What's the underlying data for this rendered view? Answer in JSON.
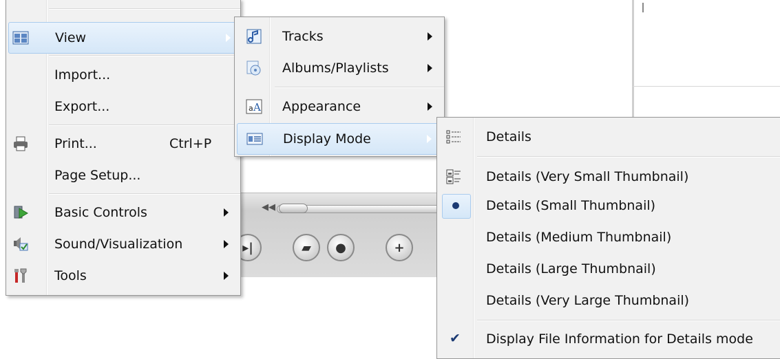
{
  "file_menu": {
    "items": [
      {
        "label": "View",
        "icon": "view-grid-icon",
        "submenu": true,
        "highlighted": true
      },
      {
        "label": "Import..."
      },
      {
        "label": "Export..."
      },
      {
        "label": "Print...",
        "icon": "printer-icon",
        "shortcut": "Ctrl+P"
      },
      {
        "label": "Page Setup..."
      },
      {
        "label": "Basic Controls",
        "icon": "basic-controls-icon",
        "submenu": true
      },
      {
        "label": "Sound/Visualization",
        "icon": "sound-visualization-icon",
        "submenu": true
      },
      {
        "label": "Tools",
        "icon": "tools-icon",
        "submenu": true
      }
    ]
  },
  "view_menu": {
    "items": [
      {
        "label": "Tracks",
        "icon": "tracks-icon",
        "submenu": true
      },
      {
        "label": "Albums/Playlists",
        "icon": "albums-icon",
        "submenu": true
      },
      {
        "label": "Appearance",
        "icon": "appearance-icon",
        "submenu": true
      },
      {
        "label": "Display Mode",
        "icon": "display-mode-icon",
        "submenu": true,
        "highlighted": true
      }
    ]
  },
  "display_mode_menu": {
    "items": [
      {
        "label": "Details",
        "icon": "details-list-icon"
      },
      {
        "label": "Details (Very Small Thumbnail)",
        "icon": "details-thumbnail-icon"
      },
      {
        "label": "Details (Small Thumbnail)",
        "selected": true
      },
      {
        "label": "Details (Medium Thumbnail)"
      },
      {
        "label": "Details (Large Thumbnail)"
      },
      {
        "label": "Details (Very Large Thumbnail)"
      },
      {
        "label": "Display File Information for Details mode",
        "checked": true
      }
    ]
  },
  "colors": {
    "menu_bg": "#f1f1f1",
    "highlight": "#d5e7f8",
    "highlight_border": "#a9cbee",
    "radio": "#1b3a73"
  }
}
